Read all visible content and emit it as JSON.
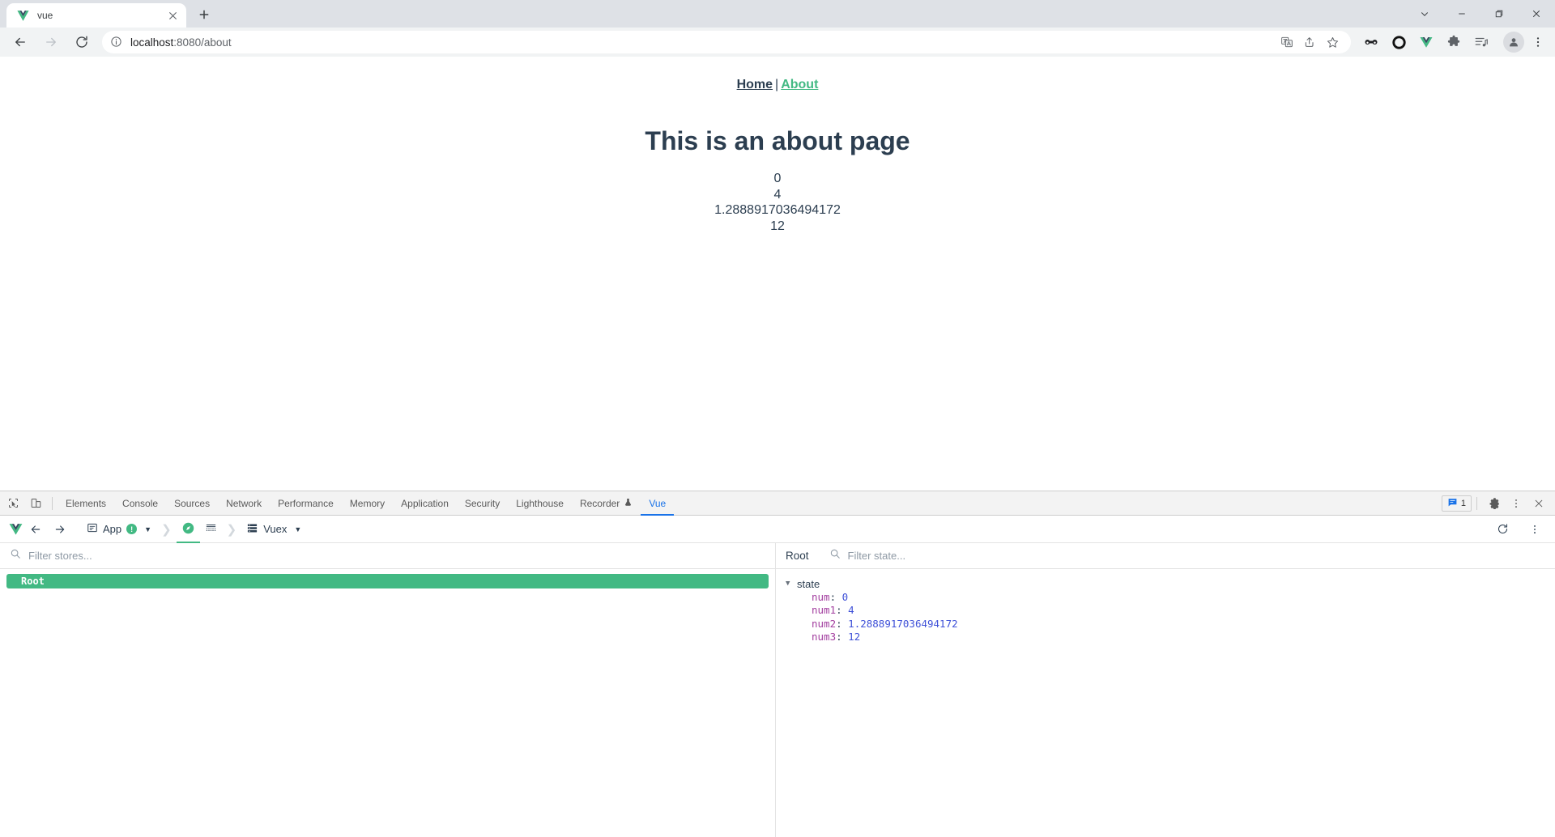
{
  "browser": {
    "tab": {
      "title": "vue",
      "favicon": "vue-logo-icon",
      "close": "close-icon"
    },
    "new_tab": "new-tab-icon",
    "window_controls": [
      "chevron-down-icon",
      "minimize-icon",
      "maximize-icon",
      "close-icon"
    ],
    "nav": {
      "back": "back-arrow-icon",
      "forward": "forward-arrow-icon",
      "reload": "reload-icon"
    },
    "omnibox": {
      "info_icon": "info-circle-icon",
      "host": "localhost",
      "path": ":8080/about",
      "full_url": "localhost:8080/about",
      "actions": [
        "translate-icon",
        "share-icon",
        "bookmark-star-icon"
      ]
    },
    "extensions": [
      "glasses-extension-icon",
      "circle-extension-icon",
      "vue-devtools-icon",
      "puzzle-extensions-icon",
      "reading-list-icon"
    ],
    "profile": "avatar-icon",
    "menu": "kebab-menu-icon"
  },
  "page": {
    "nav": {
      "home": "Home",
      "separator": "|",
      "about": "About"
    },
    "heading": "This is an about page",
    "values": [
      "0",
      "4",
      "1.2888917036494172",
      "12"
    ]
  },
  "devtools": {
    "left_icons": [
      "inspect-element-icon",
      "device-toolbar-icon"
    ],
    "tabs": [
      {
        "label": "Elements",
        "active": false
      },
      {
        "label": "Console",
        "active": false
      },
      {
        "label": "Sources",
        "active": false
      },
      {
        "label": "Network",
        "active": false
      },
      {
        "label": "Performance",
        "active": false
      },
      {
        "label": "Memory",
        "active": false
      },
      {
        "label": "Application",
        "active": false
      },
      {
        "label": "Security",
        "active": false
      },
      {
        "label": "Lighthouse",
        "active": false
      },
      {
        "label": "Recorder",
        "active": false,
        "icon": "flask-icon"
      },
      {
        "label": "Vue",
        "active": true
      }
    ],
    "message_count": "1",
    "right_icons": [
      "messages-icon",
      "settings-gear-icon",
      "kebab-menu-icon",
      "close-devtools-icon"
    ],
    "active_tab_color": "#1a73e8"
  },
  "vue_devtools": {
    "logo": "vue-logo-icon",
    "back": "back-arrow-icon",
    "forward": "forward-arrow-icon",
    "breadcrumbs": [
      {
        "label": "App",
        "icon": "component-icon",
        "badge": "!",
        "caret": true,
        "active": false
      },
      {
        "label": "",
        "icon": "compass-icon",
        "active": true
      },
      {
        "label": "",
        "icon": "timeline-icon",
        "active": false
      },
      {
        "label": "Vuex",
        "icon": "list-icon",
        "caret": true,
        "active": false
      }
    ],
    "refresh": "refresh-icon",
    "more": "kebab-menu-icon",
    "accent_color": "#42b983",
    "left_pane": {
      "filter_placeholder": "Filter stores...",
      "search_icon": "search-icon",
      "stores": [
        {
          "label": "Root",
          "selected": true
        }
      ]
    },
    "right_pane": {
      "title": "Root",
      "filter_placeholder": "Filter state...",
      "search_icon": "search-icon",
      "tree": {
        "label": "state",
        "expanded": true,
        "entries": [
          {
            "key": "num",
            "value": "0"
          },
          {
            "key": "num1",
            "value": "4"
          },
          {
            "key": "num2",
            "value": "1.2888917036494172"
          },
          {
            "key": "num3",
            "value": "12"
          }
        ]
      }
    }
  }
}
